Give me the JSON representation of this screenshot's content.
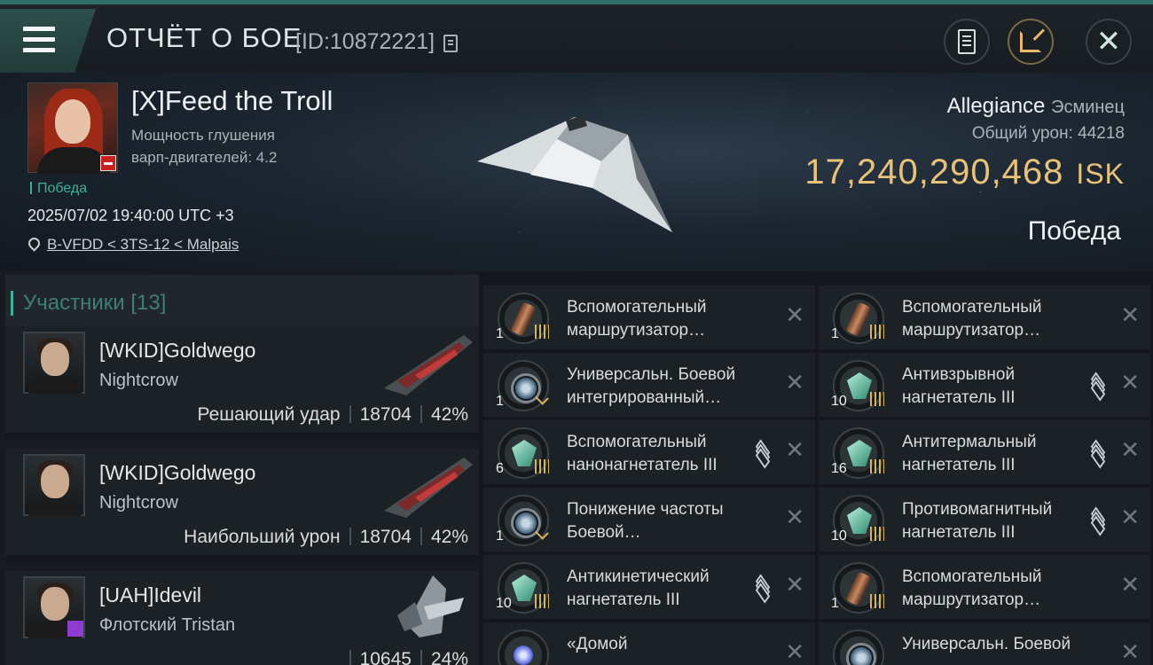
{
  "header": {
    "title": "ОТЧЁТ О БОЕ",
    "report_id": "[ID:10872221]"
  },
  "victim": {
    "name": "[X]Feed the Troll",
    "stat_line1": "Мощность глушения",
    "stat_line2": "варп-двигателей: 4.2",
    "result_tag": "Победа",
    "datetime": "2025/07/02 19:40:00 UTC +3",
    "location": "B-VFDD < 3TS-12 < Malpais",
    "ship_name": "Allegiance",
    "ship_class": "Эсминец",
    "damage_label": "Общий урон:",
    "damage_value": "44218",
    "isk_value": "17,240,290,468",
    "isk_unit": "ISK",
    "outcome": "Победа"
  },
  "participants": {
    "header": "Участники [13]",
    "rows": [
      {
        "name": "[WKID]Goldwego",
        "ship": "Nightcrow",
        "role": "Решающий удар",
        "damage": "18704",
        "percent": "42%"
      },
      {
        "name": "[WKID]Goldwego",
        "ship": "Nightcrow",
        "role": "Наибольший урон",
        "damage": "18704",
        "percent": "42%"
      },
      {
        "name": "[UAH]Idevil",
        "ship": "Флотский Tristan",
        "role": "",
        "damage": "10645",
        "percent": "24%"
      }
    ]
  },
  "items": [
    {
      "qty": "1",
      "name1": "Вспомогательный",
      "name2": "маршрутизатор…",
      "icon": "cylinder-module",
      "stackable": false
    },
    {
      "qty": "1",
      "name1": "Вспомогательный",
      "name2": "маршрутизатор…",
      "icon": "cylinder-module",
      "stackable": false
    },
    {
      "qty": "1",
      "name1": "Универсальн. Боевой",
      "name2": " интегрированный…",
      "icon": "lens-module",
      "stackable": false
    },
    {
      "qty": "10",
      "name1": "Антивзрывной",
      "name2": "нагнетатель III",
      "icon": "crystal-module",
      "stackable": true
    },
    {
      "qty": "6",
      "name1": "Вспомогательный",
      "name2": "нанонагнетатель III",
      "icon": "crystal-module",
      "stackable": true
    },
    {
      "qty": "16",
      "name1": "Антитермальный",
      "name2": "нагнетатель III",
      "icon": "crystal-module",
      "stackable": true
    },
    {
      "qty": "1",
      "name1": "Понижение частоты",
      "name2": "Боевой…",
      "icon": "lens-module",
      "stackable": false
    },
    {
      "qty": "10",
      "name1": "Противомагнитный",
      "name2": "нагнетатель III",
      "icon": "crystal-module",
      "stackable": true
    },
    {
      "qty": "10",
      "name1": "Антикинетический",
      "name2": "нагнетатель III",
      "icon": "crystal-module",
      "stackable": true
    },
    {
      "qty": "1",
      "name1": "Вспомогательный",
      "name2": "маршрутизатор…",
      "icon": "cylinder-module",
      "stackable": false
    },
    {
      "qty": "",
      "name1": "«Домой",
      "name2": "",
      "icon": "blue-orb-module",
      "stackable": false
    },
    {
      "qty": "",
      "name1": "Универсальн. Боевой",
      "name2": "",
      "icon": "lens-module",
      "stackable": false
    }
  ],
  "colors": {
    "accent": "#3fae9a",
    "isk": "#e8c27a",
    "background": "#14181c"
  }
}
